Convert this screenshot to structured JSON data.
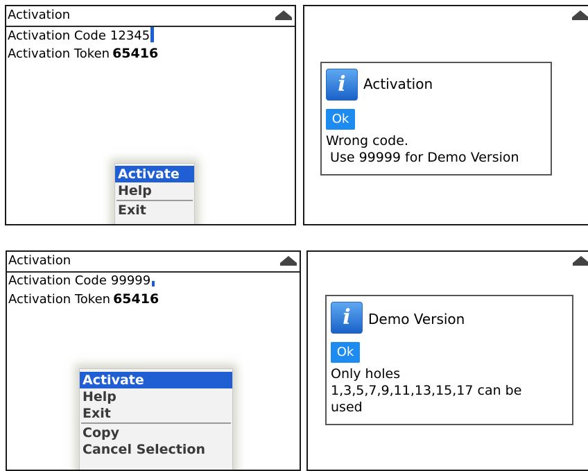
{
  "panel_tl": {
    "title": "Activation",
    "code_label": "Activation Code",
    "code_value": "12345",
    "token_label": "Activation Token",
    "token_value": "65416",
    "menu": [
      "Activate",
      "Help",
      "Exit"
    ]
  },
  "panel_tr": {
    "dialog_title": "Activation",
    "ok_label": "Ok",
    "message": "Wrong code.\n Use 99999 for Demo Version"
  },
  "panel_bl": {
    "title": "Activation",
    "code_label": "Activation Code",
    "code_value": "99999",
    "token_label": "Activation Token",
    "token_value": "65416",
    "menu_group1": [
      "Activate",
      "Help",
      "Exit"
    ],
    "menu_group2": [
      "Copy",
      "Cancel Selection"
    ]
  },
  "panel_br": {
    "dialog_title": "Demo Version",
    "ok_label": "Ok",
    "message": "Only holes\n1,3,5,7,9,11,13,15,17 can be\nused"
  },
  "colors": {
    "highlight": "#1f5fd3",
    "ok_button": "#1e8bf0",
    "cursor": "#1a5fd6"
  }
}
